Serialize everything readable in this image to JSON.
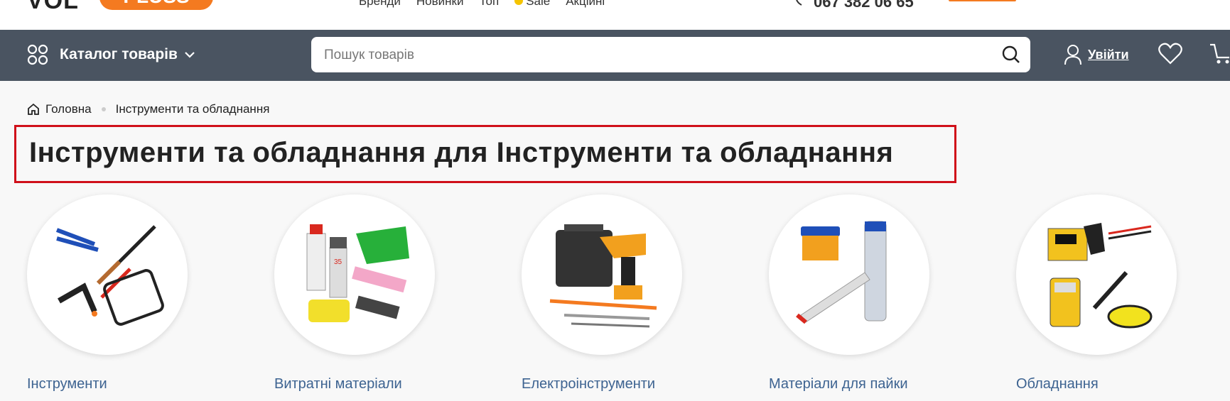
{
  "header": {
    "logo_text": "VOL",
    "logo_badge": "PLUSS",
    "nav": [
      "Бренди",
      "Новинки",
      "Топ",
      "Sale",
      "Акційні"
    ],
    "phone": "067 382 06 65"
  },
  "navbar": {
    "catalog_label": "Каталог товарів",
    "search_placeholder": "Пошук товарів",
    "login_label": "Увійти"
  },
  "breadcrumb": {
    "home": "Головна",
    "current": "Інструменти та обладнання"
  },
  "page_title": "Інструменти та обладнання для Інструменти та обладнання",
  "categories": [
    {
      "label": "Інструменти"
    },
    {
      "label": "Витратні матеріали"
    },
    {
      "label": "Електроінструменти"
    },
    {
      "label": "Матеріали для пайки"
    },
    {
      "label": "Обладнання"
    }
  ],
  "colors": {
    "navbar": "#4a5461",
    "accent": "#f47a20",
    "title_border": "#d0101a",
    "category_link": "#3d6391"
  }
}
